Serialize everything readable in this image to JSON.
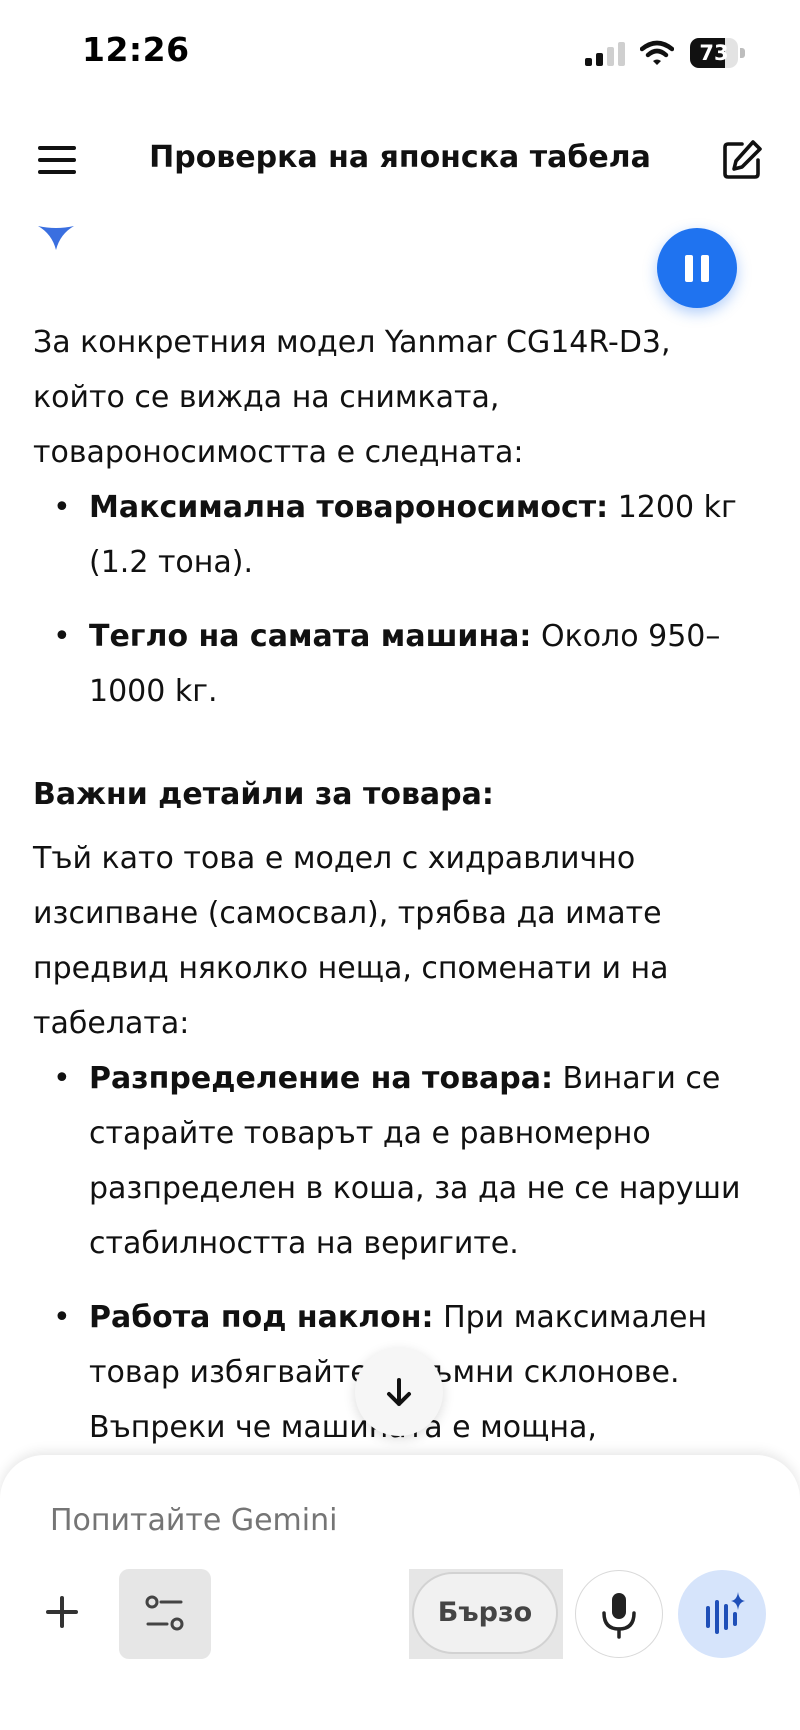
{
  "status_bar": {
    "time": "12:26",
    "battery_level": "73",
    "battery_fraction": 0.73,
    "icons": [
      "signal-icon",
      "wifi-icon",
      "battery-icon"
    ]
  },
  "header": {
    "title": "Проверка на японска табела",
    "icons": [
      "menu-icon",
      "edit-icon"
    ]
  },
  "message": {
    "intro": "За конкретния модел Yanmar CG14R-D3, който се вижда на снимката, товароносимостта е следната:",
    "specs": [
      {
        "label": "Максимална товароносимост:",
        "value": " 1200 kг (1.2 тона)."
      },
      {
        "label": "Тегло на самата машина:",
        "value": " Около 950–1000 kг."
      }
    ],
    "heading": "Важни детайли за товара:",
    "paragraph": "Тъй като това е модел с хидравлично изсипване (самосвал), трябва да имате предвид няколко неща, споменати и на табелата:",
    "details": [
      {
        "label": "Разпределение на товара:",
        "value": " Винаги се старайте товарът да е равномерно разпределен в коша, за да не се наруши стабилността на веригите."
      },
      {
        "label": "Работа под наклон:",
        "value": " При максимален товар избягвайте стръмни склонове. Въпреки че машината е мощна,"
      }
    ]
  },
  "composer": {
    "placeholder": "Попитайте Gemini",
    "mode_label": "Бързо",
    "icons": [
      "plus-icon",
      "tools-icon",
      "microphone-icon",
      "live-waveform-icon",
      "scroll-down-arrow-icon",
      "pause-icon",
      "gemini-spark-icon"
    ]
  },
  "colors": {
    "accent": "#1f73f0",
    "live_button_bg": "#d6e4fb",
    "text": "#111111",
    "placeholder": "#707070"
  }
}
